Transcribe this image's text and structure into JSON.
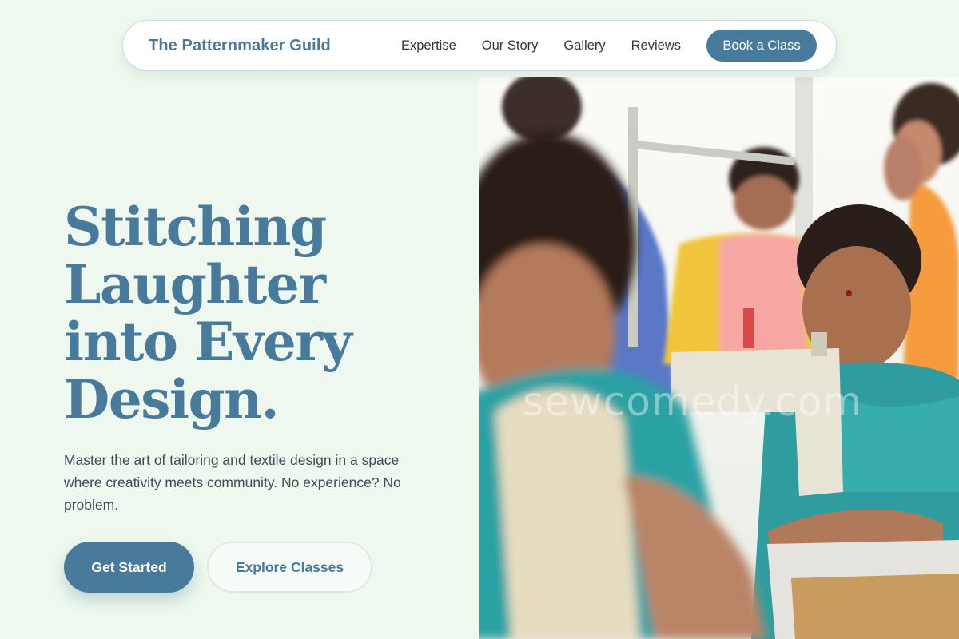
{
  "nav": {
    "brand": "The Patternmaker Guild",
    "links": [
      {
        "label": "Expertise"
      },
      {
        "label": "Our Story"
      },
      {
        "label": "Gallery"
      },
      {
        "label": "Reviews"
      }
    ],
    "cta_label": "Book a Class"
  },
  "hero": {
    "title_lines": [
      "Stitching",
      "Laughter",
      "into Every",
      "Design."
    ],
    "subtitle": "Master the art of tailoring and textile design in a space where creativity meets community. No experience? No problem.",
    "primary_button": "Get Started",
    "secondary_button": "Explore Classes"
  },
  "image": {
    "watermark": "sewcomedy.com"
  },
  "colors": {
    "page_background": "#eef8ee",
    "accent": "#487a9b",
    "text": "#3f4a56"
  }
}
